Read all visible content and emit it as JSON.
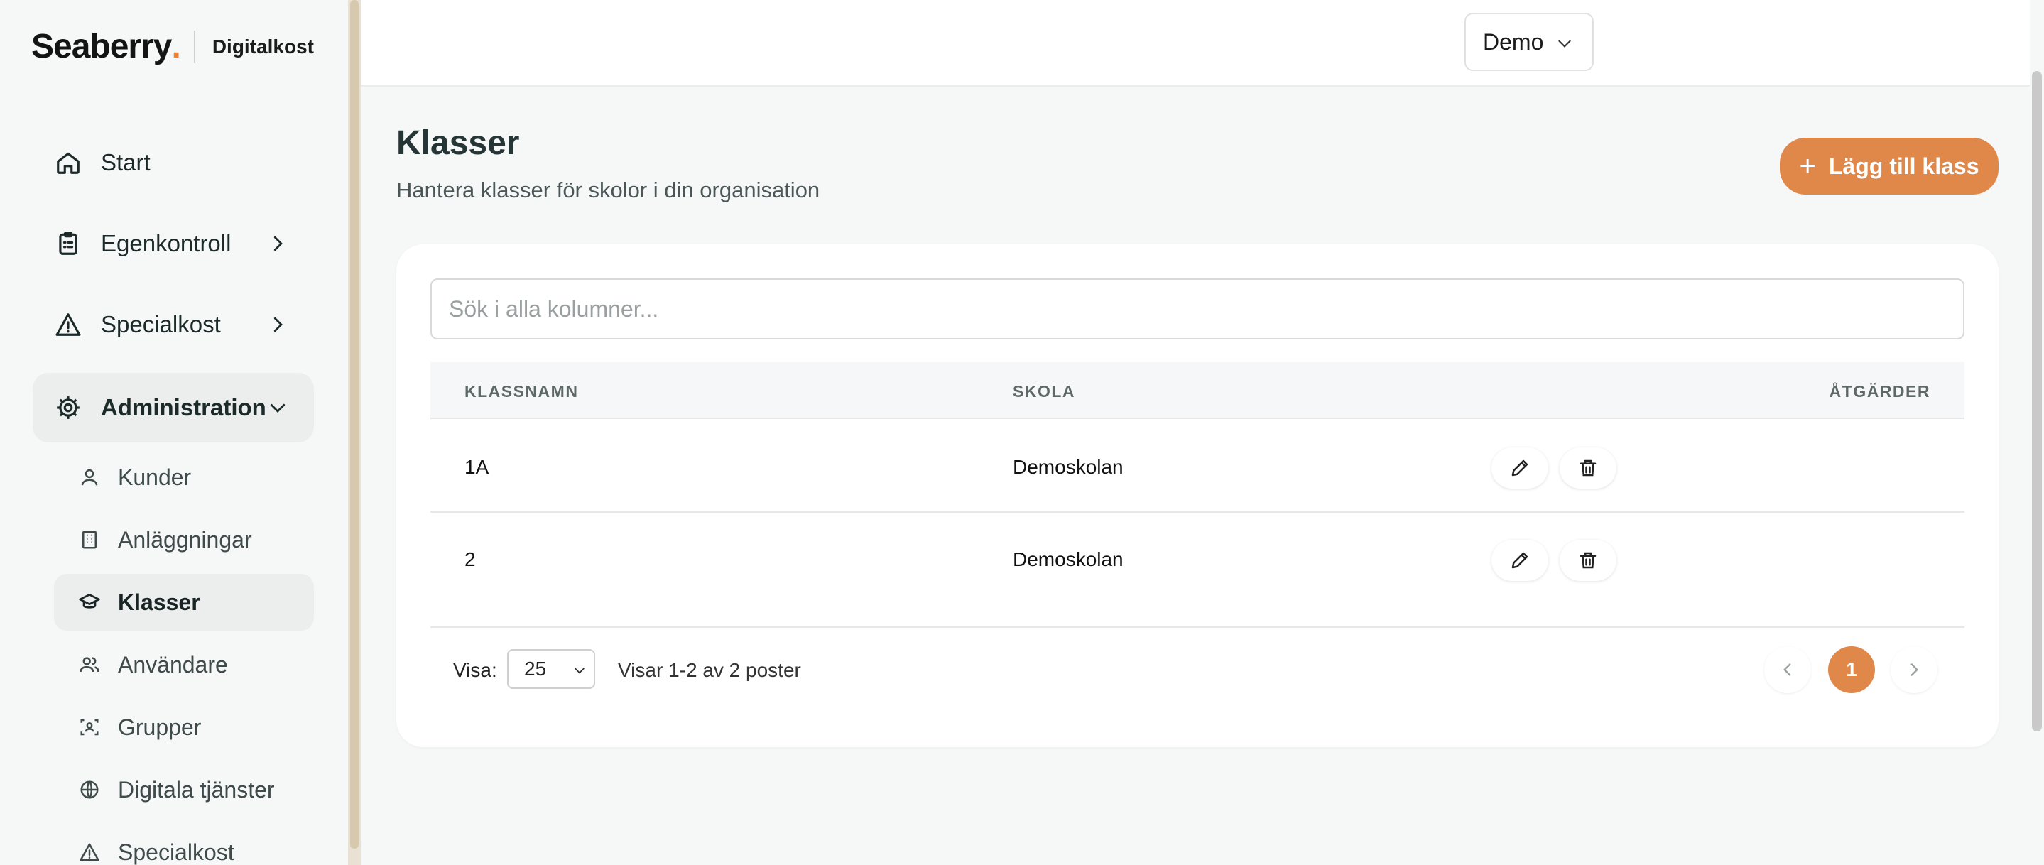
{
  "brand": {
    "name": "Seaberry",
    "product": "Digitalkost",
    "accent": "#e8833a"
  },
  "org_select": {
    "value": "Demo"
  },
  "sidebar": {
    "main_items": [
      {
        "label": "Start",
        "icon": "home-icon"
      },
      {
        "label": "Egenkontroll",
        "icon": "clipboard-icon"
      },
      {
        "label": "Specialkost",
        "icon": "warning-icon"
      },
      {
        "label": "Administration",
        "icon": "gear-icon"
      }
    ],
    "admin_items": [
      {
        "label": "Kunder",
        "icon": "user-icon"
      },
      {
        "label": "Anläggningar",
        "icon": "building-icon"
      },
      {
        "label": "Klasser",
        "icon": "graduation-cap-icon"
      },
      {
        "label": "Användare",
        "icon": "users-icon"
      },
      {
        "label": "Grupper",
        "icon": "group-icon"
      },
      {
        "label": "Digitala tjänster",
        "icon": "globe-icon"
      },
      {
        "label": "Specialkost",
        "icon": "warning-icon"
      }
    ]
  },
  "page": {
    "title": "Klasser",
    "subtitle": "Hantera klasser för skolor i din organisation",
    "add_button": "Lägg till klass"
  },
  "search": {
    "placeholder": "Sök i alla kolumner..."
  },
  "table": {
    "headers": {
      "name": "KLASSNAMN",
      "school": "SKOLA",
      "actions": "ÅTGÄRDER"
    },
    "rows": [
      {
        "name": "1A",
        "school": "Demoskolan"
      },
      {
        "name": "2",
        "school": "Demoskolan"
      }
    ]
  },
  "pagination": {
    "show_label": "Visa:",
    "page_size": "25",
    "summary": "Visar 1-2 av 2 poster",
    "current_page": "1"
  },
  "colors": {
    "accent": "#e0874a",
    "sidebar_bg": "#f6f7f7"
  }
}
